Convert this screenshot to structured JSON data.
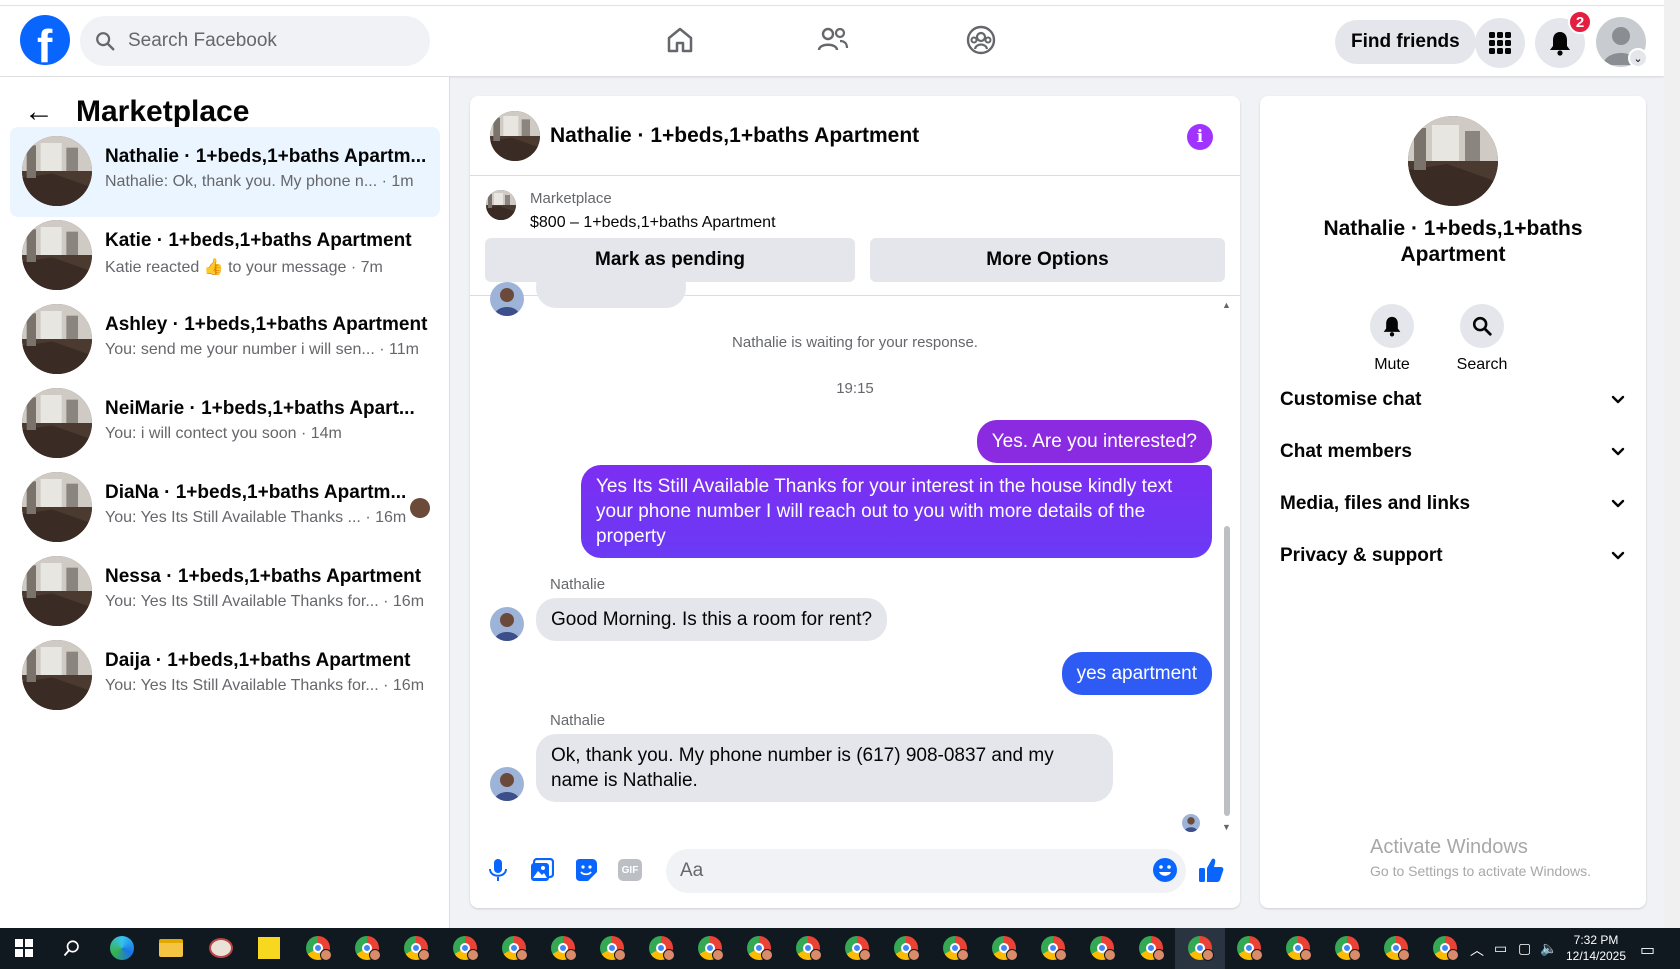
{
  "header": {
    "search_placeholder": "Search Facebook",
    "find_friends_label": "Find friends",
    "notification_count": "2",
    "icons": [
      "facebook-logo-icon",
      "search-icon",
      "home-icon",
      "friends-icon",
      "groups-icon",
      "menu-grid-icon",
      "bell-icon",
      "profile-avatar"
    ]
  },
  "sidebar": {
    "title": "Marketplace",
    "conversations": [
      {
        "title": "Nathalie · 1+beds,1+baths Apartm...",
        "preview": "Nathalie: Ok, thank you. My phone n...",
        "time": "1m",
        "active": true
      },
      {
        "title": "Katie · 1+beds,1+baths Apartment",
        "preview": "Katie reacted 👍 to your message",
        "time": "7m"
      },
      {
        "title": "Ashley · 1+beds,1+baths Apartment",
        "preview": "You: send me your number i will sen...",
        "time": "11m"
      },
      {
        "title": "NeiMarie · 1+beds,1+baths Apart...",
        "preview": "You: i will contect you soon",
        "time": "14m"
      },
      {
        "title": "DiaNa · 1+beds,1+baths Apartm...",
        "preview": "You: Yes Its Still Available Thanks ...",
        "time": "16m"
      },
      {
        "title": "Nessa · 1+beds,1+baths Apartment",
        "preview": "You: Yes Its Still Available Thanks for...",
        "time": "16m"
      },
      {
        "title": "Daija · 1+beds,1+baths Apartment",
        "preview": "You: Yes Its Still Available Thanks for...",
        "time": "16m"
      }
    ]
  },
  "chat": {
    "title": "Nathalie · 1+beds,1+baths Apartment",
    "marketplace_label": "Marketplace",
    "listing": "$800 – 1+beds,1+baths Apartment",
    "mark_pending_label": "Mark as pending",
    "more_options_label": "More Options",
    "waiting_text": "Nathalie is waiting for your response.",
    "timestamp": "19:15",
    "messages": {
      "m1": "Yes. Are you interested?",
      "m2": "Yes Its Still Available Thanks for your interest in the house kindly text your phone number I will reach out to you with more details of the property",
      "sender1": "Nathalie",
      "m3": "Good Morning. Is this a room for rent?",
      "m4": "yes apartment",
      "sender2": "Nathalie",
      "m5": "Ok, thank you. My phone number is (617) 908-0837 and my name is Nathalie."
    },
    "composer_placeholder": "Aa"
  },
  "details": {
    "name": "Nathalie · 1+beds,1+baths Apartment",
    "mute_label": "Mute",
    "search_label": "Search",
    "sections": [
      "Customise chat",
      "Chat members",
      "Media, files and links",
      "Privacy & support"
    ]
  },
  "watermark": {
    "line1": "Activate Windows",
    "line2": "Go to Settings to activate Windows."
  },
  "taskbar": {
    "time": "7:32 PM",
    "date": "12/14/2025"
  },
  "colors": {
    "brand": "#0866ff",
    "bubble_purple": "#8a2be2",
    "bubble_blue": "#2f5bf5"
  }
}
